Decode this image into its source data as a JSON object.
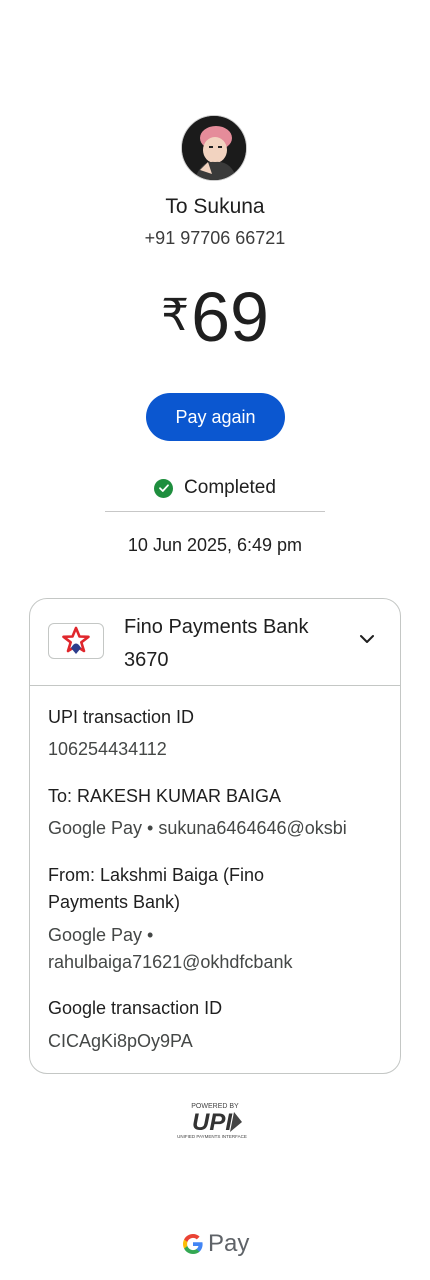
{
  "payee": {
    "name": "To Sukuna",
    "phone": "+91 97706 66721"
  },
  "amount": {
    "currency_symbol": "₹",
    "value": "69"
  },
  "actions": {
    "pay_again_label": "Pay again"
  },
  "status": {
    "text": "Completed",
    "color": "#1e8e3e"
  },
  "datetime": "10 Jun 2025, 6:49 pm",
  "bank": {
    "name_line1": "Fino Payments Bank",
    "name_line2": "3670"
  },
  "details": [
    {
      "label": "UPI transaction ID",
      "value": "106254434112"
    },
    {
      "label": "To: RAKESH KUMAR BAIGA",
      "value": "Google Pay • sukuna6464646@oksbi"
    },
    {
      "label": "From: Lakshmi  Baiga (Fino Payments Bank)",
      "value": "Google Pay • rahulbaiga71621@okhdfcbank"
    },
    {
      "label": "Google transaction ID",
      "value": "CICAgKi8pOy9PA"
    }
  ],
  "footer": {
    "upi_powered": "POWERED BY",
    "upi_name": "UPI",
    "upi_sub": "UNIFIED PAYMENTS INTERFACE",
    "gpay_label": "Pay"
  },
  "colors": {
    "accent": "#0b57d0",
    "success": "#1e8e3e"
  }
}
